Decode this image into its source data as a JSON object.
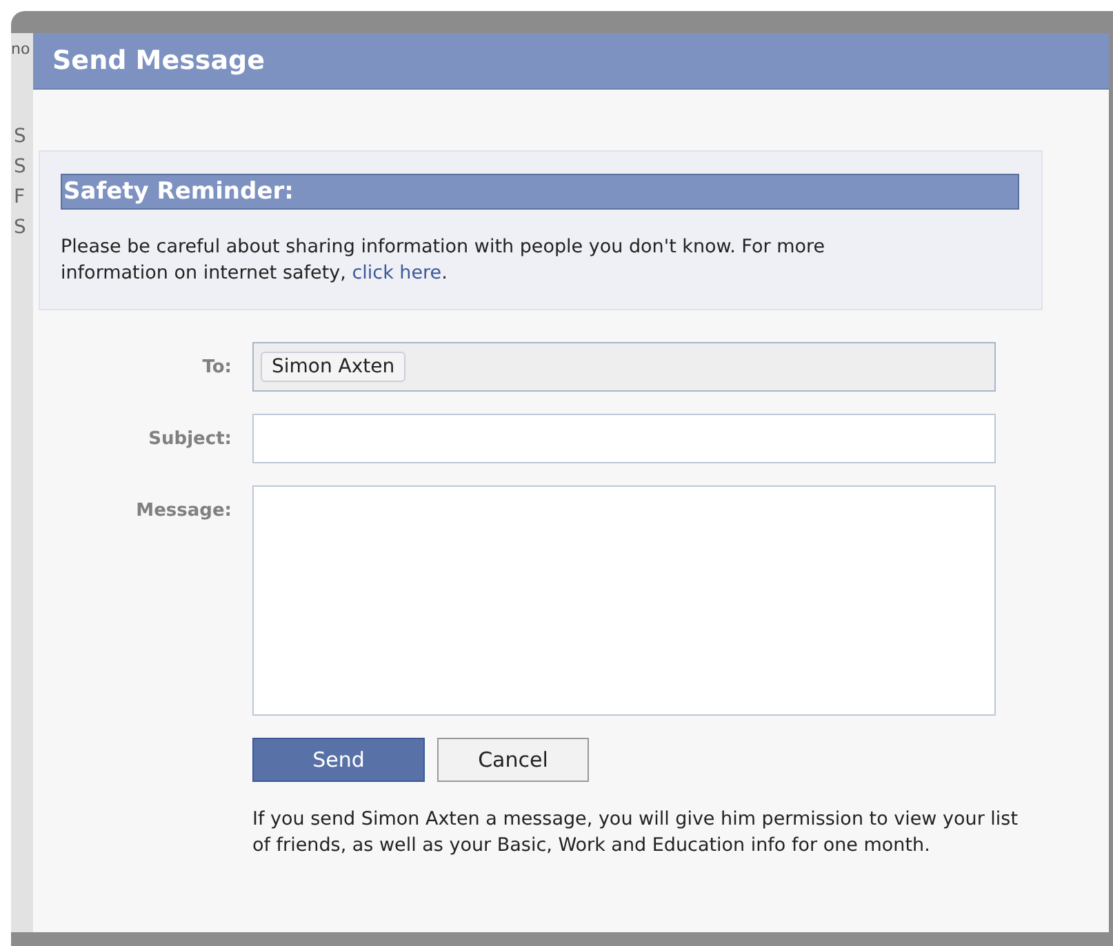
{
  "background": {
    "fragments": [
      "no",
      "S",
      "S",
      "F",
      "S"
    ]
  },
  "dialog": {
    "title": "Send Message"
  },
  "safety_reminder": {
    "title": "Safety Reminder:",
    "text": "Please be careful about sharing information with people you don't know. For more information on internet safety, ",
    "link": "click here",
    "after_link": "."
  },
  "form": {
    "to": {
      "label": "To:",
      "recipients": [
        "Simon Axten"
      ]
    },
    "subject": {
      "label": "Subject:"
    },
    "message": {
      "label": "Message:"
    }
  },
  "buttons": [
    {
      "label": "Send",
      "kind": "primary"
    },
    {
      "label": "Cancel",
      "kind": "secondary"
    }
  ],
  "notice": "If you send Simon Axten a message, you will give him permission to view your list of friends, as well as your Basic, Work and Education info for one month."
}
